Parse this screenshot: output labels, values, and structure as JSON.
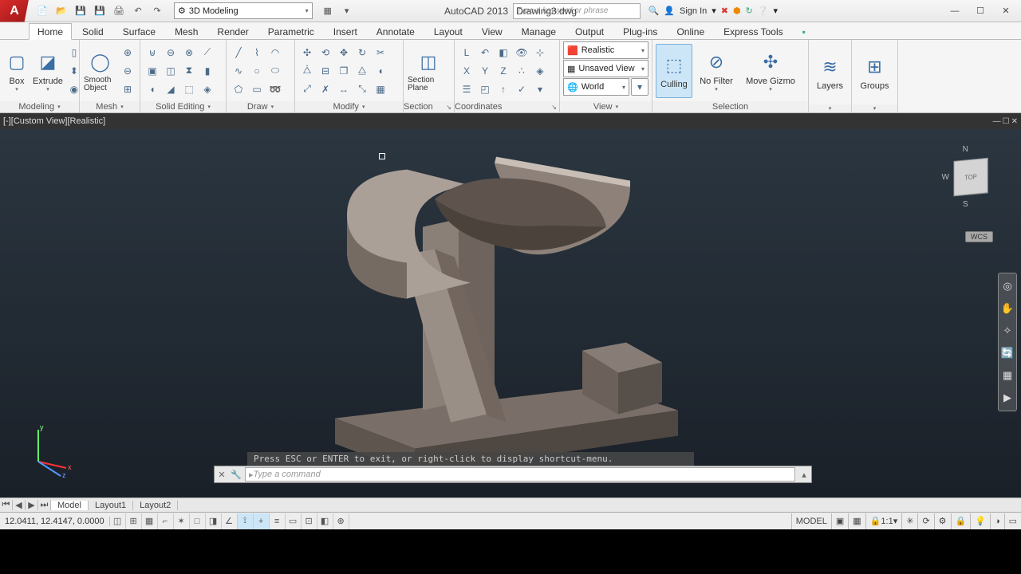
{
  "title": {
    "app": "AutoCAD 2013",
    "file": "Drawing3.dwg"
  },
  "workspace": "3D Modeling",
  "search_placeholder": "Type a keyword or phrase",
  "signin": "Sign In",
  "tabs": [
    "Home",
    "Solid",
    "Surface",
    "Mesh",
    "Render",
    "Parametric",
    "Insert",
    "Annotate",
    "Layout",
    "View",
    "Manage",
    "Output",
    "Plug-ins",
    "Online",
    "Express Tools"
  ],
  "active_tab": "Home",
  "panels": {
    "modeling": {
      "label": "Modeling",
      "box": "Box",
      "extrude": "Extrude"
    },
    "mesh": {
      "label": "Mesh",
      "smooth": "Smooth Object"
    },
    "solid_editing": {
      "label": "Solid Editing"
    },
    "draw": {
      "label": "Draw"
    },
    "modify": {
      "label": "Modify"
    },
    "section": {
      "label": "Section",
      "plane": "Section Plane"
    },
    "coordinates": {
      "label": "Coordinates"
    },
    "view": {
      "label": "View",
      "style": "Realistic",
      "saved": "Unsaved View",
      "ucs": "World"
    },
    "selection": {
      "label": "Selection",
      "culling": "Culling",
      "nofilter": "No Filter",
      "gizmo": "Move Gizmo"
    },
    "layers": {
      "label": "Layers"
    },
    "groups": {
      "label": "Groups"
    }
  },
  "viewport": {
    "label": "[-][Custom View][Realistic]",
    "wcs": "WCS",
    "cube": {
      "n": "N",
      "s": "S",
      "w": "W",
      "top": "TOP"
    }
  },
  "cmd": {
    "hint": "Press ESC or ENTER to exit, or right-click to display shortcut-menu.",
    "placeholder": "Type a command"
  },
  "layout_tabs": {
    "model": "Model",
    "l1": "Layout1",
    "l2": "Layout2"
  },
  "status": {
    "coords": "12.0411, 12.4147, 0.0000",
    "model": "MODEL",
    "scale": "1:1"
  }
}
